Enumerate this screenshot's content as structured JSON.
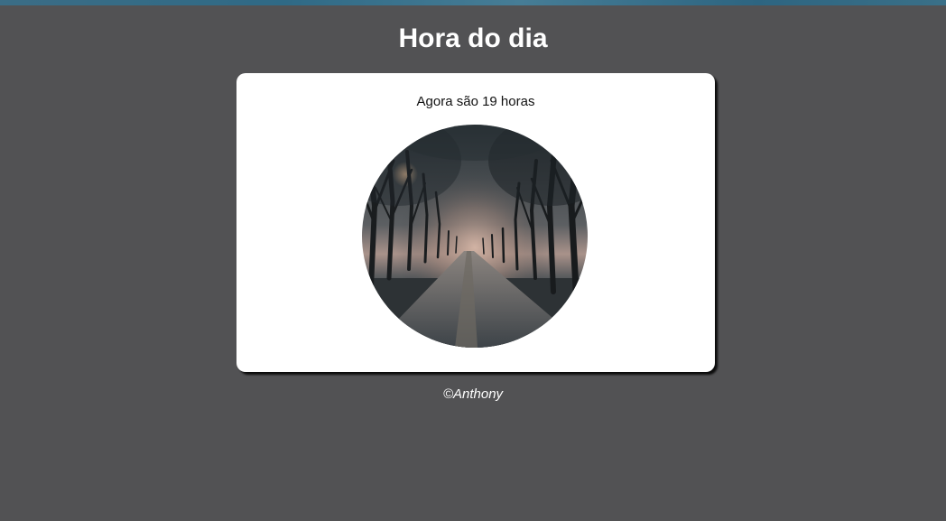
{
  "header": {
    "title": "Hora do dia"
  },
  "card": {
    "message": "Agora são 19 horas",
    "image_subject": "foggy tree-lined path at dusk"
  },
  "footer": {
    "copyright": "©Anthony"
  },
  "colors": {
    "background": "#525254",
    "card": "#ffffff",
    "title": "#ffffff",
    "message": "#111111",
    "accent_strip": "#3b6d86"
  }
}
